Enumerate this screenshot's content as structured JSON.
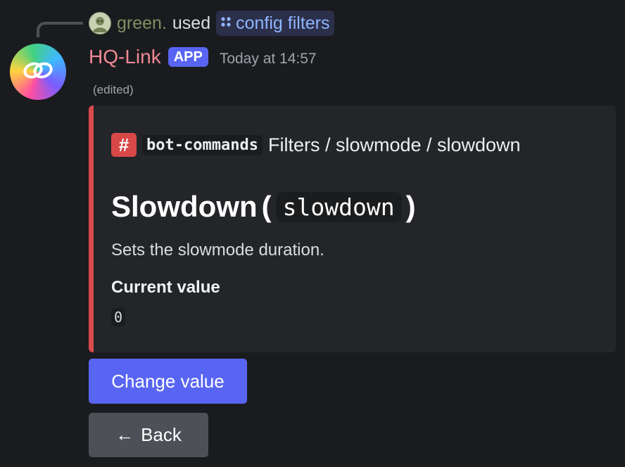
{
  "reply": {
    "username": "green.",
    "used_text": "used",
    "command": "config filters",
    "avatar_icon": "user-avatar-icon",
    "command_icon": "slash-command-icon"
  },
  "message": {
    "bot_name": "HQ-Link",
    "badge": "APP",
    "timestamp": "Today at 14:57",
    "edited": "(edited)",
    "avatar_icon": "chain-link-icon"
  },
  "embed": {
    "accent_color": "#da4b4b",
    "channel_icon": "#",
    "channel": "bot-commands",
    "path": "Filters / slowmode / slowdown",
    "title_text": "Slowdown",
    "title_open": "(",
    "title_code": "slowdown",
    "title_close": ")",
    "description": "Sets the slowmode duration.",
    "field_name": "Current value",
    "field_value": "0"
  },
  "buttons": {
    "change_label": "Change value",
    "back_arrow": "←",
    "back_label": "Back"
  },
  "colors": {
    "background": "#1a1b1e",
    "blurple": "#5865f2",
    "secondary_button": "#4e5058",
    "bot_name": "#f08a95"
  }
}
